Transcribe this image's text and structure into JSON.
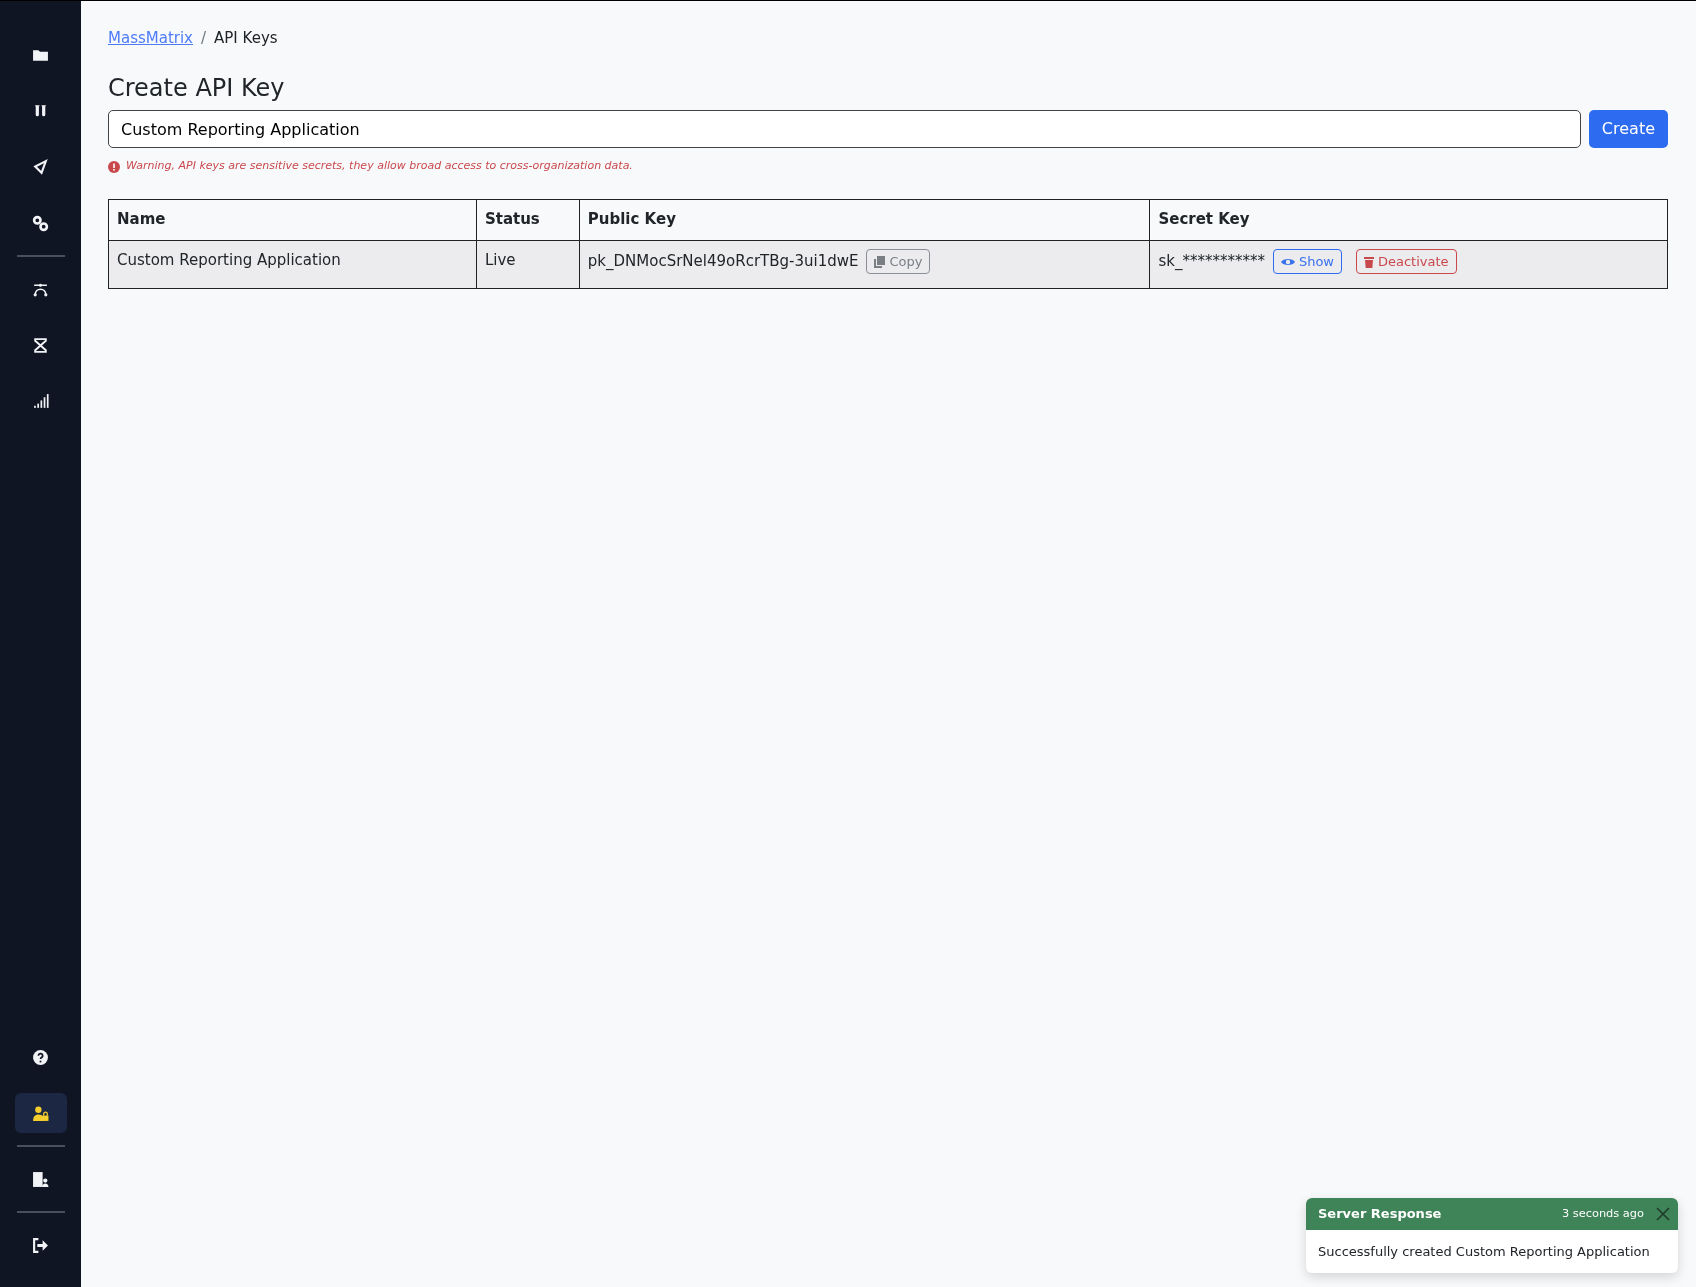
{
  "sidebar": {
    "groups": [
      {
        "items": [
          {
            "selected": false
          },
          {
            "selected": false
          },
          {
            "selected": false
          },
          {
            "selected": false
          }
        ]
      },
      {
        "items": [
          {
            "selected": false
          },
          {
            "selected": false
          },
          {
            "selected": false
          }
        ]
      },
      {
        "items": [
          {
            "selected": false
          },
          {
            "selected": true
          }
        ]
      },
      {
        "items": [
          {
            "selected": false
          }
        ]
      },
      {
        "items": [
          {
            "selected": false
          }
        ]
      }
    ]
  },
  "breadcrumb": [
    {
      "label": "MassMatrix",
      "kind": "link"
    },
    {
      "separator": "/",
      "label": "API Keys",
      "kind": "current"
    }
  ],
  "heading": "Create API Key",
  "name_field": {
    "value": "Custom Reporting Application"
  },
  "create_button": "Create",
  "warning": "Warning, API keys are sensitive secrets, they allow broad access to cross-organization data.",
  "table": {
    "columns": [
      "Name",
      "Status",
      "Public Key",
      "Secret Key"
    ],
    "rows": [
      {
        "name": "Custom Reporting Application",
        "status": "Live",
        "public_key": "pk_DNMocSrNel49oRcrTBg-3ui1dwE",
        "copy_button": "Copy",
        "secret_key": "sk_***********",
        "show_button": "Show",
        "deactivate_button": "Deactivate"
      }
    ]
  },
  "toast": {
    "title": "Server Response",
    "time": "3 seconds ago",
    "message": "Successfully created Custom Reporting Application"
  }
}
